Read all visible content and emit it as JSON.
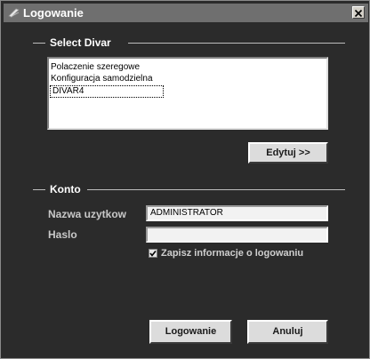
{
  "window": {
    "title": "Logowanie"
  },
  "select_divar": {
    "group_label": "Select Divar",
    "items": [
      "Polaczenie szeregowe",
      "Konfiguracja samodzielna",
      "DIVAR4"
    ],
    "edit_button": "Edytuj >>"
  },
  "konto": {
    "group_label": "Konto",
    "username_label": "Nazwa uzytkow",
    "username_value": "ADMINISTRATOR",
    "password_label": "Haslo",
    "password_value": "",
    "remember_label": "Zapisz informacje o logowaniu",
    "remember_checked": true
  },
  "buttons": {
    "login": "Logowanie",
    "cancel": "Anuluj"
  },
  "icons": {
    "title": "app-icon",
    "close": "close-icon",
    "check": "checkmark-icon"
  },
  "colors": {
    "background": "#2b2b2b",
    "titlebar": "#6f6f6f",
    "button": "#dcdcdc"
  }
}
